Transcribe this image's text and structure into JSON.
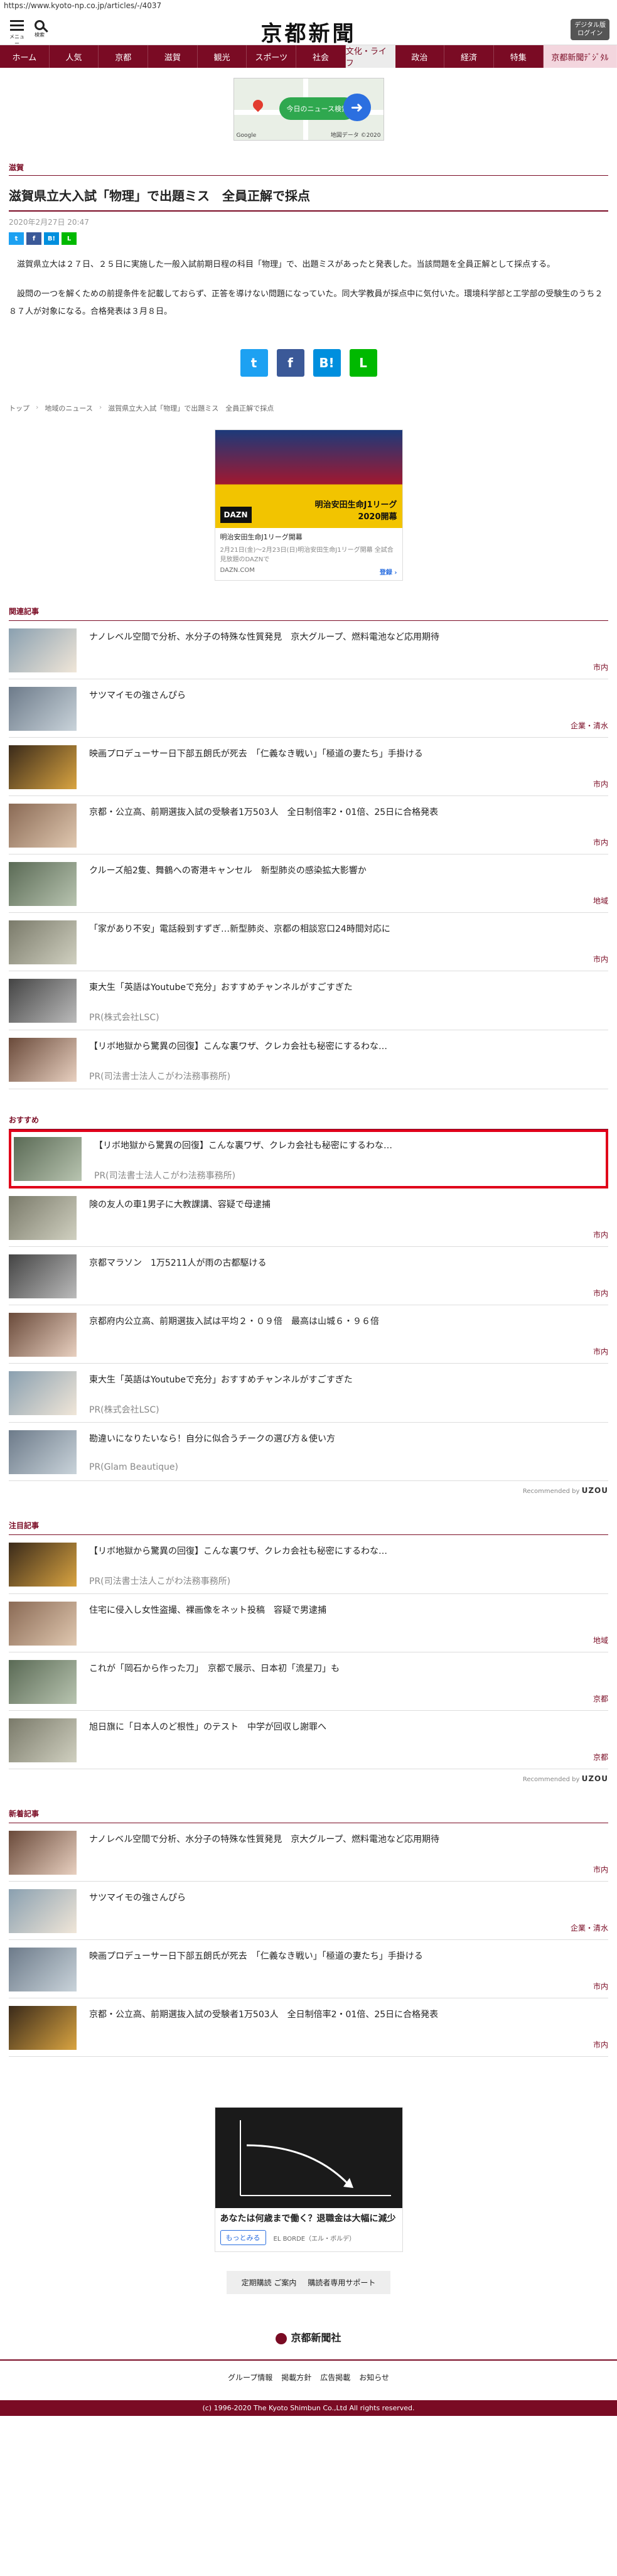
{
  "url": "https://www.kyoto-np.co.jp/articles/-/4037",
  "header": {
    "menu_label": "メニュー",
    "search_label": "検索",
    "logo": "京都新聞",
    "digital_btn": "デジタル版\nログイン"
  },
  "nav": [
    "ホーム",
    "人気",
    "京都",
    "滋賀",
    "観光",
    "スポーツ",
    "社会",
    "文化・ライフ",
    "政治",
    "経済",
    "特集",
    "京都新聞ﾃﾞｼﾞﾀﾙ"
  ],
  "nav_active": 7,
  "map_ad": {
    "pill": "今日のニュース検索",
    "credit": "地図データ ©2020",
    "google": "Google"
  },
  "article": {
    "category": "滋賀",
    "title": "滋賀県立大入試「物理」で出題ミス　全員正解で採点",
    "date": "2020年2月27日 20:47",
    "paragraphs": [
      "滋賀県立大は２７日、２５日に実施した一般入試前期日程の科目「物理」で、出題ミスがあったと発表した。当該問題を全員正解として採点する。",
      "設問の一つを解くための前提条件を記載しておらず、正答を導けない問題になっていた。同大学教員が採点中に気付いた。環境科学部と工学部の受験生のうち２８７人が対象になる。合格発表は３月８日。"
    ],
    "share_small": [
      "t",
      "f",
      "B!",
      "L"
    ],
    "share_big": [
      "t",
      "f",
      "B!",
      "L"
    ]
  },
  "breadcrumb": [
    "トップ",
    "地域のニュース",
    "滋賀県立大入試「物理」で出題ミス　全員正解で採点"
  ],
  "ad_square": {
    "banner": "明治安田生命J1リーグ\n2020開幕",
    "dazn": "DAZN",
    "title": "明治安田生命J1リーグ開幕",
    "sub": "2月21日(金)～2月23日(日)明治安田生命J1リーグ開幕 全試合見放題のDAZNで",
    "domain": "DAZN.COM",
    "register": "登録 ›"
  },
  "related": {
    "heading": "関連記事",
    "items": [
      {
        "title": "ナノレベル空間で分析、水分子の特殊な性質発見　京大グループ、燃料電池など応用期待",
        "tag": "市内",
        "pr": ""
      },
      {
        "title": "サツマイモの強さんぴら",
        "tag": "企業・清水",
        "pr": ""
      },
      {
        "title": "映画プロデューサー日下部五朗氏が死去　「仁義なき戦い」「極道の妻たち」手掛ける",
        "tag": "市内",
        "pr": ""
      },
      {
        "title": "京都・公立高、前期選抜入試の受験者1万503人　全日制倍率2・01倍、25日に合格発表",
        "tag": "市内",
        "pr": ""
      },
      {
        "title": "クルーズ船2隻、舞鶴への寄港キャンセル　新型肺炎の感染拡大影響か",
        "tag": "地域",
        "pr": ""
      },
      {
        "title": "「家があり不安」電話殺到すずぎ…新型肺炎、京都の相談窓口24時間対応に",
        "tag": "市内",
        "pr": ""
      },
      {
        "title": "東大生「英語はYoutubeで充分」おすすめチャンネルがすごすぎた",
        "tag": "",
        "pr": "PR(株式会社LSC)"
      },
      {
        "title": "【リボ地獄から驚異の回復】こんな裏ワザ、クレカ会社も秘密にするわな…",
        "tag": "",
        "pr": "PR(司法書士法人こがわ法務事務所)"
      }
    ]
  },
  "recommended": {
    "heading": "おすすめ",
    "items": [
      {
        "title": "【リボ地獄から驚異の回復】こんな裏ワザ、クレカ会社も秘密にするわな…",
        "tag": "",
        "pr": "PR(司法書士法人こがわ法務事務所)"
      },
      {
        "title": "険の友人の車1男子に大教課講、容疑で母逮捕",
        "tag": "市内",
        "pr": ""
      },
      {
        "title": "京都マラソン　1万5211人が雨の古都駆ける",
        "tag": "市内",
        "pr": ""
      },
      {
        "title": "京都府内公立高、前期選抜入試は平均２・０９倍　最高は山城６・９６倍",
        "tag": "市内",
        "pr": ""
      },
      {
        "title": "東大生「英語はYoutubeで充分」おすすめチャンネルがすごすぎた",
        "tag": "",
        "pr": "PR(株式会社LSC)"
      },
      {
        "title": "勘違いになりたいなら！自分に似合うチークの選び方＆使い方",
        "tag": "",
        "pr": "PR(Glam Beautique)"
      }
    ],
    "by": "Recommended by",
    "brand": "UZOU"
  },
  "attention": {
    "heading": "注目記事",
    "items": [
      {
        "title": "【リボ地獄から驚異の回復】こんな裏ワザ、クレカ会社も秘密にするわな…",
        "tag": "",
        "pr": "PR(司法書士法人こがわ法務事務所)"
      },
      {
        "title": "住宅に侵入し女性盗撮、裸画像をネット投稿　容疑で男逮捕",
        "tag": "地域",
        "pr": ""
      },
      {
        "title": "これが「岡石から作った刀」　京都で展示、日本初「流星刀」も",
        "tag": "京都",
        "pr": ""
      },
      {
        "title": "旭日旗に「日本人のど根性」のテスト　中学が回収し謝罪へ",
        "tag": "京都",
        "pr": ""
      }
    ],
    "by": "Recommended by",
    "brand": "UZOU"
  },
  "latest": {
    "heading": "新着記事",
    "items": [
      {
        "title": "ナノレベル空間で分析、水分子の特殊な性質発見　京大グループ、燃料電池など応用期待",
        "tag": "市内",
        "pr": ""
      },
      {
        "title": "サツマイモの強さんぴら",
        "tag": "企業・清水",
        "pr": ""
      },
      {
        "title": "映画プロデューサー日下部五朗氏が死去　「仁義なき戦い」「極道の妻たち」手掛ける",
        "tag": "市内",
        "pr": ""
      },
      {
        "title": "京都・公立高、前期選抜入試の受験者1万503人　全日制倍率2・01倍、25日に合格発表",
        "tag": "市内",
        "pr": ""
      }
    ]
  },
  "ad_bottom": {
    "title": "あなたは何歳まで働く？退職金は大幅に減少",
    "btn": "もっとみる",
    "sponsor": "EL BORDE（エル・ボルデ）"
  },
  "sub_links": [
    "定期購読 ご案内",
    "購読者専用サポート"
  ],
  "footer": {
    "logo": "京都新聞社",
    "links": [
      "グループ情報",
      "掲載方針",
      "広告掲載",
      "お知らせ"
    ],
    "copyright": "(c) 1996-2020 The Kyoto Shimbun Co.,Ltd All rights reserved."
  }
}
